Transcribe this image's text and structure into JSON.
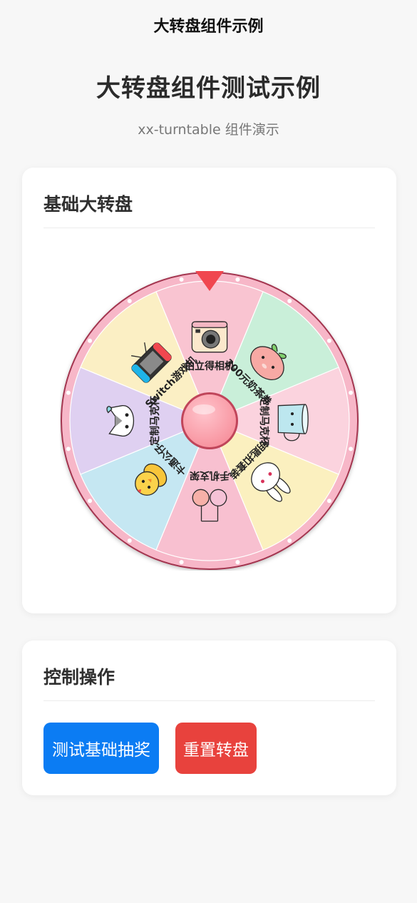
{
  "navbar": {
    "title": "大转盘组件示例"
  },
  "header": {
    "title": "大转盘组件测试示例",
    "subtitle": "xx-turntable 组件演示"
  },
  "basic_card": {
    "title": "基础大转盘"
  },
  "turntable": {
    "prizes": [
      {
        "label": "拍立得相机",
        "color": "#f9c4d1",
        "icon": "instant-camera-icon"
      },
      {
        "label": "300元奶茶券",
        "color": "#c9efd9",
        "icon": "milk-tea-voucher-icon"
      },
      {
        "label": "定制马克杯",
        "color": "#fbd3de",
        "icon": "mug-icon"
      },
      {
        "label": "钥匙扣套装",
        "color": "#fbf0bf",
        "icon": "bunny-keychain-icon"
      },
      {
        "label": "手机支架",
        "color": "#f8c0d0",
        "icon": "phone-stand-icon"
      },
      {
        "label": "卡通公仔",
        "color": "#c5e7f2",
        "icon": "chick-doll-icon"
      },
      {
        "label": "定制马克杯",
        "color": "#dfd0f1",
        "icon": "cat-face-icon"
      },
      {
        "label": "Switch游戏机",
        "color": "#fbefc4",
        "icon": "game-console-icon"
      }
    ],
    "pointer_color": "#f0464f",
    "rim_color": "#f7b7c8",
    "center_button_color": "#f7909c"
  },
  "control_card": {
    "title": "控制操作",
    "test_button": "测试基础抽奖",
    "reset_button": "重置转盘"
  }
}
